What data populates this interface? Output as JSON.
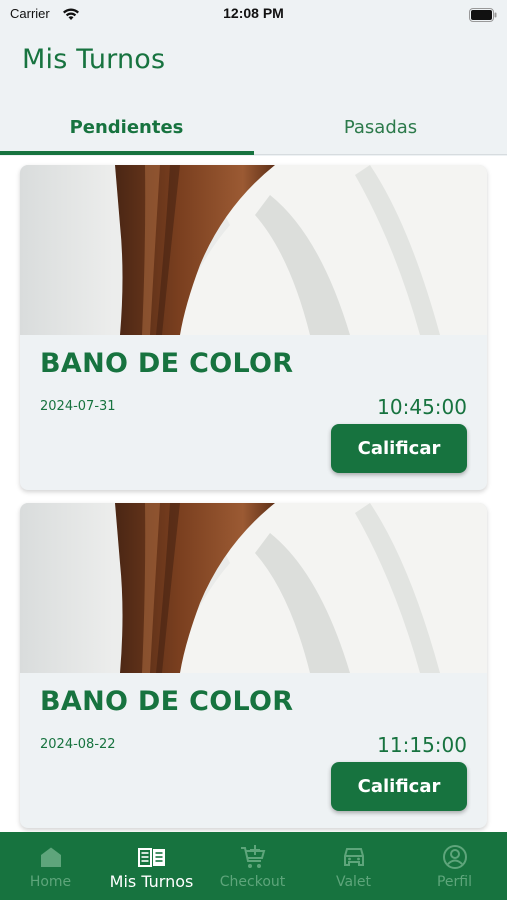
{
  "status_bar": {
    "carrier": "Carrier",
    "time": "12:08 PM"
  },
  "header": {
    "title": "Mis Turnos"
  },
  "tabs": [
    {
      "label": "Pendientes",
      "active": true
    },
    {
      "label": "Pasadas",
      "active": false
    }
  ],
  "appointments": [
    {
      "service": "BANO DE COLOR",
      "date": "2024-07-31",
      "time": "10:45:00",
      "action_label": "Calificar"
    },
    {
      "service": "BANO DE COLOR",
      "date": "2024-08-22",
      "time": "11:15:00",
      "action_label": "Calificar"
    }
  ],
  "bottom_nav": [
    {
      "label": "Home",
      "icon": "home-icon",
      "active": false
    },
    {
      "label": "Mis Turnos",
      "icon": "book-icon",
      "active": true
    },
    {
      "label": "Checkout",
      "icon": "cart-icon",
      "active": false
    },
    {
      "label": "Valet",
      "icon": "car-icon",
      "active": false
    },
    {
      "label": "Perfil",
      "icon": "profile-icon",
      "active": false
    }
  ],
  "colors": {
    "brand": "#17733f",
    "background": "#eef2f4",
    "nav_inactive": "#5ea57b"
  }
}
